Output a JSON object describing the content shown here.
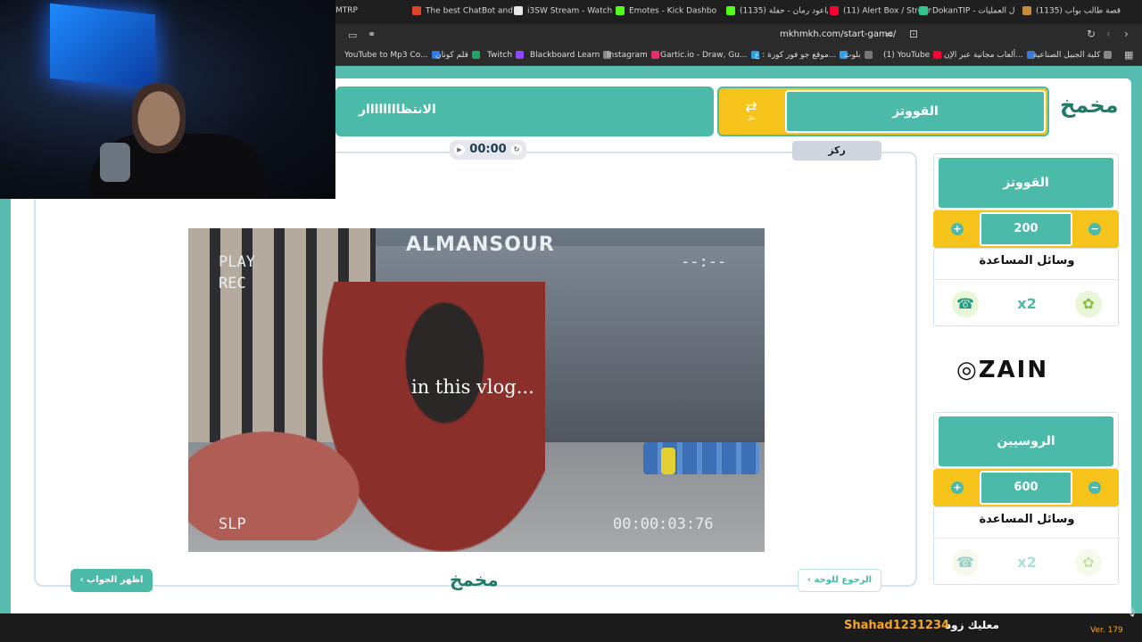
{
  "browser": {
    "tabs": [
      {
        "label": "MTRP",
        "color": "#1f1f1f"
      },
      {
        "label": "The best ChatBot and",
        "color": "#e1432b"
      },
      {
        "label": "i3SW Stream - Watch",
        "color": "#e8e8e8"
      },
      {
        "label": "Emotes - Kick Dashbo",
        "color": "#53fc18"
      },
      {
        "label": "(1135) ياعود رمان - حفلة",
        "color": "#53fc18"
      },
      {
        "label": "(11) Alert Box / Stream",
        "color": "#ff0033"
      },
      {
        "label": "DokanTIP - ل العمليات",
        "color": "#31c48d"
      },
      {
        "label": "(1135) قصة طالب بواب",
        "color": "#c58b3a"
      }
    ],
    "url": "mkhmkh.com/start-game/",
    "bookmarks": [
      {
        "label": "YouTube to Mp3 Co...",
        "color": "#2c7be5"
      },
      {
        "label": "قلم كونان",
        "color": "#1fa463"
      },
      {
        "label": "Twitch",
        "color": "#9146ff"
      },
      {
        "label": "Blackboard Learn",
        "color": "#888888"
      },
      {
        "label": "Instagram",
        "color": "#e1306c"
      },
      {
        "label": "Gartic.io - Draw, Gu...",
        "color": "#2f9ee8"
      },
      {
        "label": "موقع جو فور كورة : ع...",
        "color": "#2f9ee8"
      },
      {
        "label": "بلوت",
        "color": "#777777"
      },
      {
        "label": "(1) YouTube",
        "color": "#ff0033"
      },
      {
        "label": "ألعاب مجانية عبر الإن...",
        "color": "#3a7bd5"
      },
      {
        "label": "كلية الجبيل الصناعية",
        "color": "#888888"
      }
    ]
  },
  "game": {
    "waiting_team": "الانتظاااااااار",
    "current_turn_team": "القووتز",
    "turn_icon_label": "نقل",
    "timer": "00:00",
    "category": "ركز",
    "reveal_answer": "اظهر الجواب",
    "back_to_board": "الرجوع للوحة",
    "video": {
      "sign": "ALMANSOUR",
      "play_text": "PLAY",
      "rec_text": "REC",
      "time_placeholder": "--:--",
      "slp_text": "SLP",
      "timecode": "00:00:03:76",
      "caption": "in this vlog..."
    }
  },
  "teams": [
    {
      "name": "القووتز",
      "score": "200",
      "help_title": "وسائل المساعدة",
      "tools": [
        "call-friend",
        "double-points",
        "rest"
      ]
    },
    {
      "name": "الروسيين",
      "score": "600",
      "help_title": "وسائل المساعدة",
      "tools": [
        "call-friend",
        "double-points",
        "rest"
      ]
    }
  ],
  "sponsor": "ZAIN",
  "footer": {
    "streamer_label": "معليك زود",
    "streamer_handle": "Shahad1231234",
    "version": "Ver. 179"
  },
  "colors": {
    "teal": "#4cbaa9",
    "yellow": "#f6c31b",
    "accent_orange": "#f5a623"
  }
}
